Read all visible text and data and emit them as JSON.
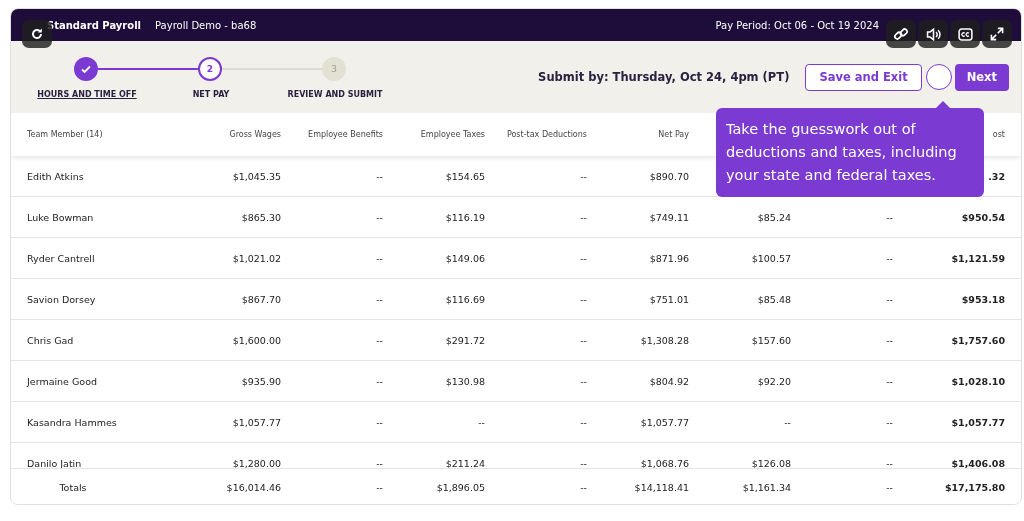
{
  "header": {
    "title": "Standard Payroll",
    "company": "Payroll Demo - ba68",
    "pay_period": "Pay Period: Oct 06 - Oct 19 2024"
  },
  "steps": [
    {
      "label": "HOURS AND TIME OFF",
      "kind": "complete"
    },
    {
      "number": "2",
      "label": "NET PAY",
      "kind": "current"
    },
    {
      "number": "3",
      "label": "REVIEW AND SUBMIT",
      "kind": "upcoming"
    }
  ],
  "submit_by": "Submit by: Thursday, Oct 24, 4pm (PT)",
  "buttons": [
    {
      "kind": "outline",
      "label": "Save and Exit"
    },
    {
      "kind": "round"
    },
    {
      "kind": "primary",
      "label": "Next"
    }
  ],
  "tooltip": "Take the guesswork out of deductions and taxes, including your state and federal taxes.",
  "table": {
    "columns": [
      "Team Member (14)",
      "Gross Wages",
      "Employee Benefits",
      "Employee Taxes",
      "Post-tax Deductions",
      "Net Pay",
      null,
      null,
      "ost"
    ],
    "rows": [
      {
        "cells": [
          "Edith Atkins",
          "$1,045.35",
          "--",
          "$154.65",
          "--",
          "$890.70",
          null,
          null,
          ".32"
        ]
      },
      {
        "cells": [
          "Luke Bowman",
          "$865.30",
          "--",
          "$116.19",
          "--",
          "$749.11",
          "$85.24",
          "--",
          "$950.54"
        ]
      },
      {
        "cells": [
          "Ryder Cantrell",
          "$1,021.02",
          "--",
          "$149.06",
          "--",
          "$871.96",
          "$100.57",
          "--",
          "$1,121.59"
        ]
      },
      {
        "cells": [
          "Savion Dorsey",
          "$867.70",
          "--",
          "$116.69",
          "--",
          "$751.01",
          "$85.48",
          "--",
          "$953.18"
        ]
      },
      {
        "cells": [
          "Chris Gad",
          "$1,600.00",
          "--",
          "$291.72",
          "--",
          "$1,308.28",
          "$157.60",
          "--",
          "$1,757.60"
        ]
      },
      {
        "cells": [
          "Jermaine Good",
          "$935.90",
          "--",
          "$130.98",
          "--",
          "$804.92",
          "$92.20",
          "--",
          "$1,028.10"
        ]
      },
      {
        "cells": [
          "Kasandra Hammes",
          "$1,057.77",
          "--",
          "--",
          "--",
          "$1,057.77",
          "--",
          "--",
          "$1,057.77"
        ]
      },
      {
        "cells": [
          "Danilo Jatin",
          "$1,280.00",
          "--",
          "$211.24",
          "--",
          "$1,068.76",
          "$126.08",
          "--",
          "$1,406.08"
        ]
      }
    ],
    "totals": [
      "Totals",
      "$16,014.46",
      "--",
      "$1,896.05",
      "--",
      "$14,118.41",
      "$1,161.34",
      "--",
      "$17,175.80"
    ]
  }
}
